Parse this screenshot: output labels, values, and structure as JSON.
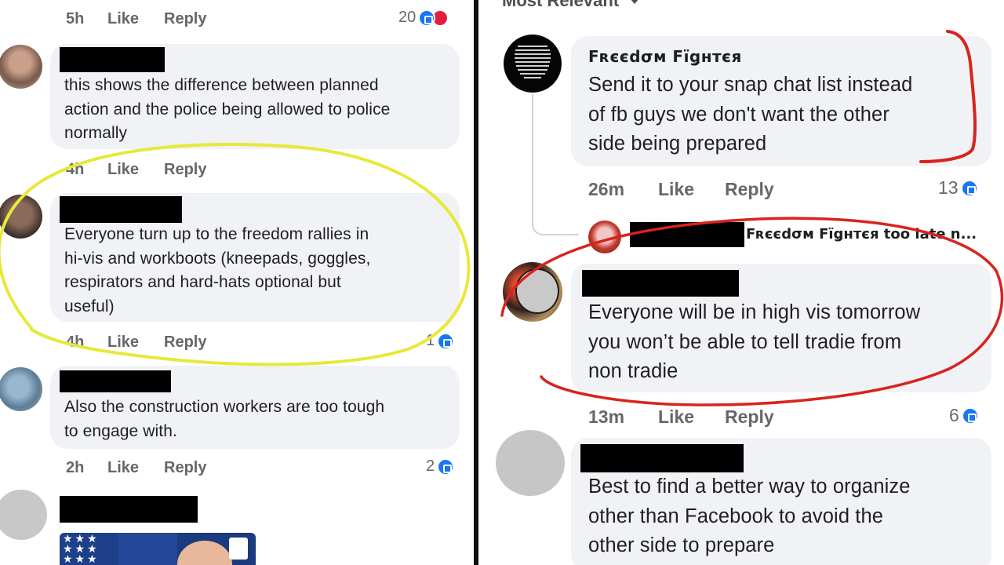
{
  "left": {
    "top_partial": {
      "time": "5h",
      "like": "Like",
      "reply": "Reply",
      "count": "20"
    },
    "comments": [
      {
        "text_lines": [
          "this shows the difference between planned",
          "action and the police being allowed to police",
          "normally"
        ],
        "time": "4h",
        "like": "Like",
        "reply": "Reply",
        "count": ""
      },
      {
        "text_lines": [
          "Everyone turn up to the freedom rallies in",
          "hi-vis and workboots (kneepads, goggles,",
          "respirators and hard-hats optional but",
          "useful)"
        ],
        "time": "4h",
        "like": "Like",
        "reply": "Reply",
        "count": "1"
      },
      {
        "text_lines": [
          "Also the construction workers are too tough",
          "to engage with."
        ],
        "time": "2h",
        "like": "Like",
        "reply": "Reply",
        "count": "2"
      }
    ]
  },
  "right": {
    "sort_label": "Most Relevant",
    "comments": [
      {
        "author": "Fʀєєdσм Fїǥнтєя",
        "text_lines": [
          "Send it to your snap chat list instead",
          "of fb guys we don't want the other",
          "side being prepared"
        ],
        "time": "26m",
        "like": "Like",
        "reply": "Reply",
        "count": "13"
      },
      {
        "reply_preview": "Fʀєєdσм Fїǥнтєя too late n..."
      },
      {
        "text_lines": [
          "Everyone will be in high vis tomorrow",
          "you won’t be able to tell tradie from",
          "non tradie"
        ],
        "time": "13m",
        "like": "Like",
        "reply": "Reply",
        "count": "6"
      },
      {
        "text_lines": [
          "Best to find a better way to organize",
          "other than Facebook to avoid the",
          "other side to prepare"
        ]
      }
    ]
  },
  "colors": {
    "yellow_circle": "#e8e83a",
    "red_circle": "#d9231d",
    "like_blue": "#1877f2",
    "bubble_bg": "#f0f2f5"
  },
  "icons": [
    "like-reaction-icon",
    "love-reaction-icon",
    "chevron-down-icon"
  ]
}
